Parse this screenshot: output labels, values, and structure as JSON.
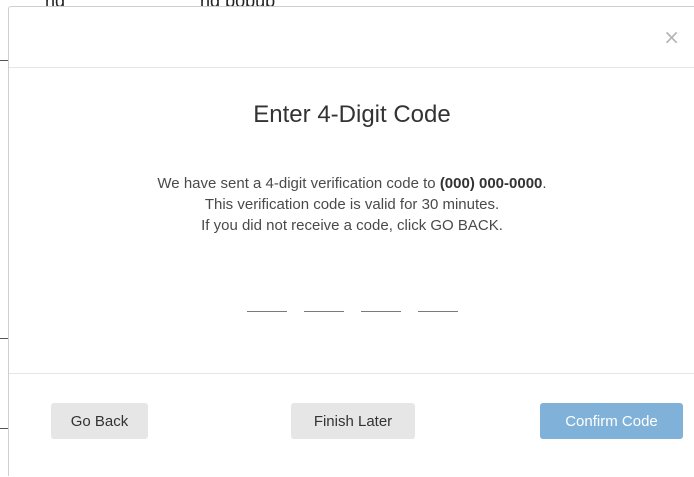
{
  "background": {
    "partial_text": "ng . . . . . ng popup . . ."
  },
  "modal": {
    "close_symbol": "×",
    "title": "Enter 4-Digit Code",
    "message": {
      "line1_prefix": "We have sent a 4-digit verification code to ",
      "phone": "(000) 000-0000",
      "line1_suffix": ".",
      "line2": "This verification code is valid for 30 minutes.",
      "line3": "If you did not receive a code, click GO BACK."
    },
    "code_digits": [
      "",
      "",
      "",
      ""
    ],
    "buttons": {
      "go_back": "Go Back",
      "finish_later": "Finish Later",
      "confirm": "Confirm Code"
    }
  },
  "colors": {
    "primary_button": "#7fb1d9",
    "secondary_button": "#e6e6e6",
    "title_text": "#333333"
  }
}
